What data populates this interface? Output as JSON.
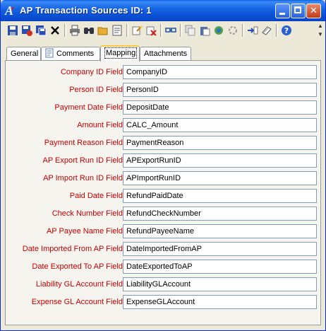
{
  "window": {
    "title": "AP Transaction Sources ID: 1",
    "minimize_glyph": "",
    "close_glyph": "✕"
  },
  "toolbar": {
    "icons": [
      "save-icon",
      "save-and-close-icon",
      "save-as-icon",
      "delete-icon",
      "print-icon",
      "find-icon",
      "open-folder-icon",
      "notes-icon",
      "wizard-icon",
      "clear-icon",
      "link-icon",
      "copy-icon",
      "paste-icon",
      "refresh-icon",
      "reload-icon",
      "import-icon",
      "attach-icon",
      "help-icon"
    ]
  },
  "tabs": [
    {
      "label": "General",
      "active": false
    },
    {
      "label": "Comments",
      "active": false,
      "icon": "notes-icon"
    },
    {
      "label": "Mapping",
      "active": true
    },
    {
      "label": "Attachments",
      "active": false
    }
  ],
  "fields": [
    {
      "label": "Company ID Field",
      "value": "CompanyID"
    },
    {
      "label": "Person ID Field",
      "value": "PersonID"
    },
    {
      "label": "Payment Date Field",
      "value": "DepositDate"
    },
    {
      "label": "Amount Field",
      "value": "CALC_Amount"
    },
    {
      "label": "Payment Reason Field",
      "value": "PaymentReason"
    },
    {
      "label": "AP Export Run ID Field",
      "value": "APExportRunID"
    },
    {
      "label": "AP Import Run ID Field",
      "value": "APImportRunID"
    },
    {
      "label": "Paid Date Field",
      "value": "RefundPaidDate"
    },
    {
      "label": "Check Number Field",
      "value": "RefundCheckNumber"
    },
    {
      "label": "AP Payee Name Field",
      "value": "RefundPayeeName"
    },
    {
      "label": "Date Imported From AP Field",
      "value": "DateImportedFromAP"
    },
    {
      "label": "Date Exported To AP Field",
      "value": "DateExportedToAP"
    },
    {
      "label": "Liability GL Account Field",
      "value": "LiabilityGLAccount"
    },
    {
      "label": "Expense GL Account Field",
      "value": "ExpenseGLAccount"
    }
  ],
  "colors": {
    "label_required": "#cc0000",
    "titlebar": "#0a52d8",
    "tab_highlight": "#ffc83c"
  }
}
